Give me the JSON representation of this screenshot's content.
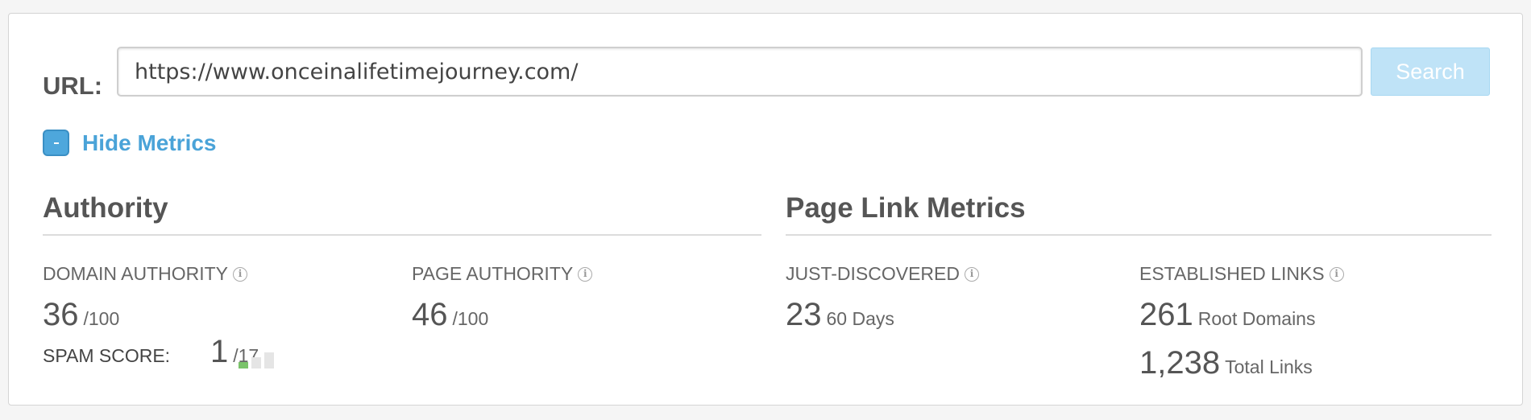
{
  "search": {
    "url_label": "URL:",
    "url_value": "https://www.onceinalifetimejourney.com/",
    "button_label": "Search"
  },
  "toggle": {
    "label": "Hide Metrics"
  },
  "authority": {
    "title": "Authority",
    "domain": {
      "label": "DOMAIN AUTHORITY",
      "value": "36",
      "suffix": "/100"
    },
    "page": {
      "label": "PAGE AUTHORITY",
      "value": "46",
      "suffix": "/100"
    },
    "spam": {
      "label": "SPAM SCORE:",
      "value": "1",
      "suffix": "/17",
      "level": 1,
      "max_level": 3
    }
  },
  "page_link_metrics": {
    "title": "Page Link Metrics",
    "just_discovered": {
      "label": "JUST-DISCOVERED",
      "value": "23",
      "suffix": "60 Days"
    },
    "established": {
      "label": "ESTABLISHED LINKS",
      "root_value": "261",
      "root_suffix": "Root Domains",
      "total_value": "1,238",
      "total_suffix": "Total Links"
    }
  },
  "colors": {
    "accent": "#4aa3d8",
    "search_button": "#bfe3f7",
    "spam_active": "#7ac36a",
    "spam_inactive": "#e5e5e5"
  },
  "icons": {
    "toggle": "minus-square-icon",
    "info": "info-circle-icon"
  }
}
